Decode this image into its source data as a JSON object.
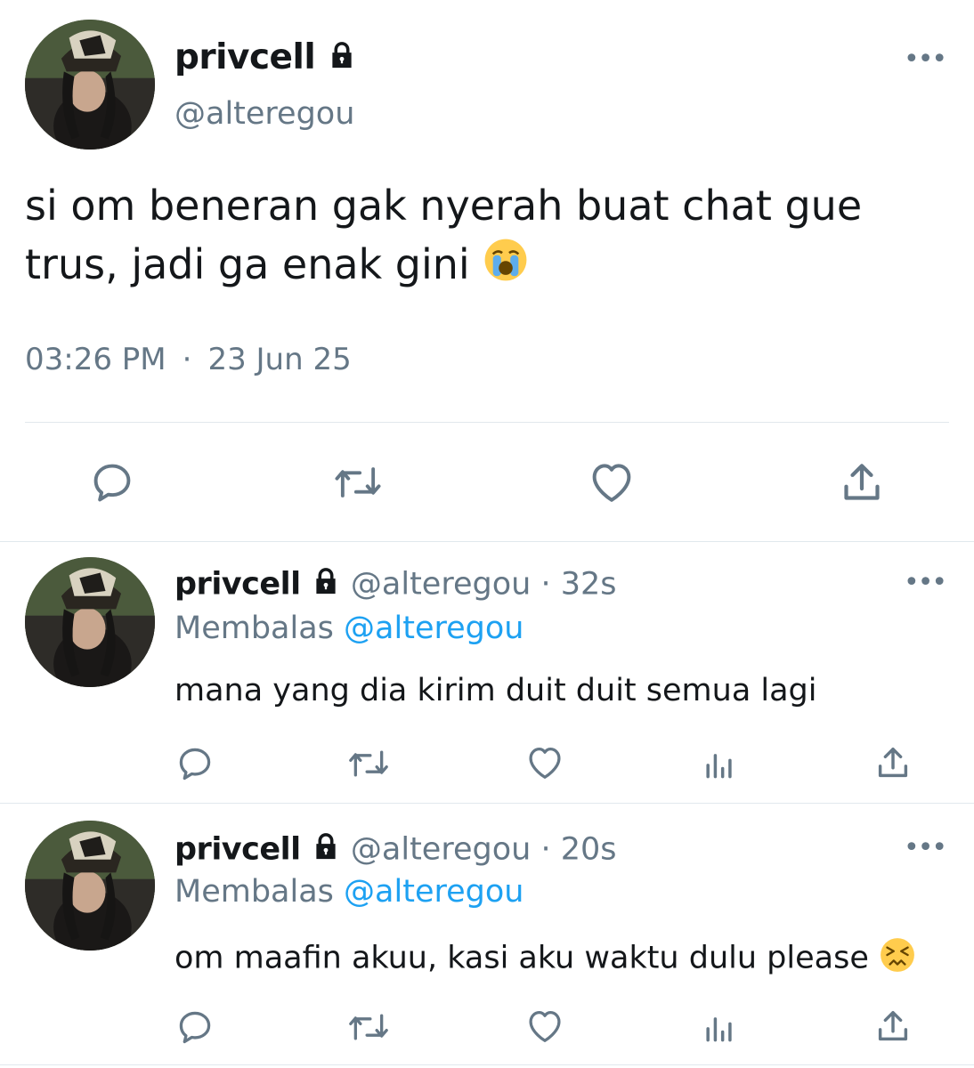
{
  "main_tweet": {
    "display_name": "privcell",
    "handle": "@alteregou",
    "text": "si om beneran gak nyerah buat chat gue trus, jadi ga enak gini",
    "emoji": "loudly-crying-face",
    "time": "03:26 PM",
    "separator": "·",
    "date": "23 Jun 25"
  },
  "replies": [
    {
      "display_name": "privcell",
      "handle": "@alteregou",
      "separator": "·",
      "age": "32s",
      "replying_label": "Membalas",
      "replying_to": "@alteregou",
      "text": "mana yang dia kirim duit duit semua lagi"
    },
    {
      "display_name": "privcell",
      "handle": "@alteregou",
      "separator": "·",
      "age": "20s",
      "replying_label": "Membalas",
      "replying_to": "@alteregou",
      "text": "om maafin akuu, kasi aku waktu dulu please",
      "emoji": "persevering-face"
    }
  ],
  "colors": {
    "text": "#14171a",
    "secondary": "#657786",
    "link": "#1da1f2",
    "divider": "#e1e8ed"
  },
  "icons": [
    "lock-icon",
    "more-icon",
    "reply-icon",
    "retweet-icon",
    "like-icon",
    "share-icon",
    "analytics-icon"
  ]
}
